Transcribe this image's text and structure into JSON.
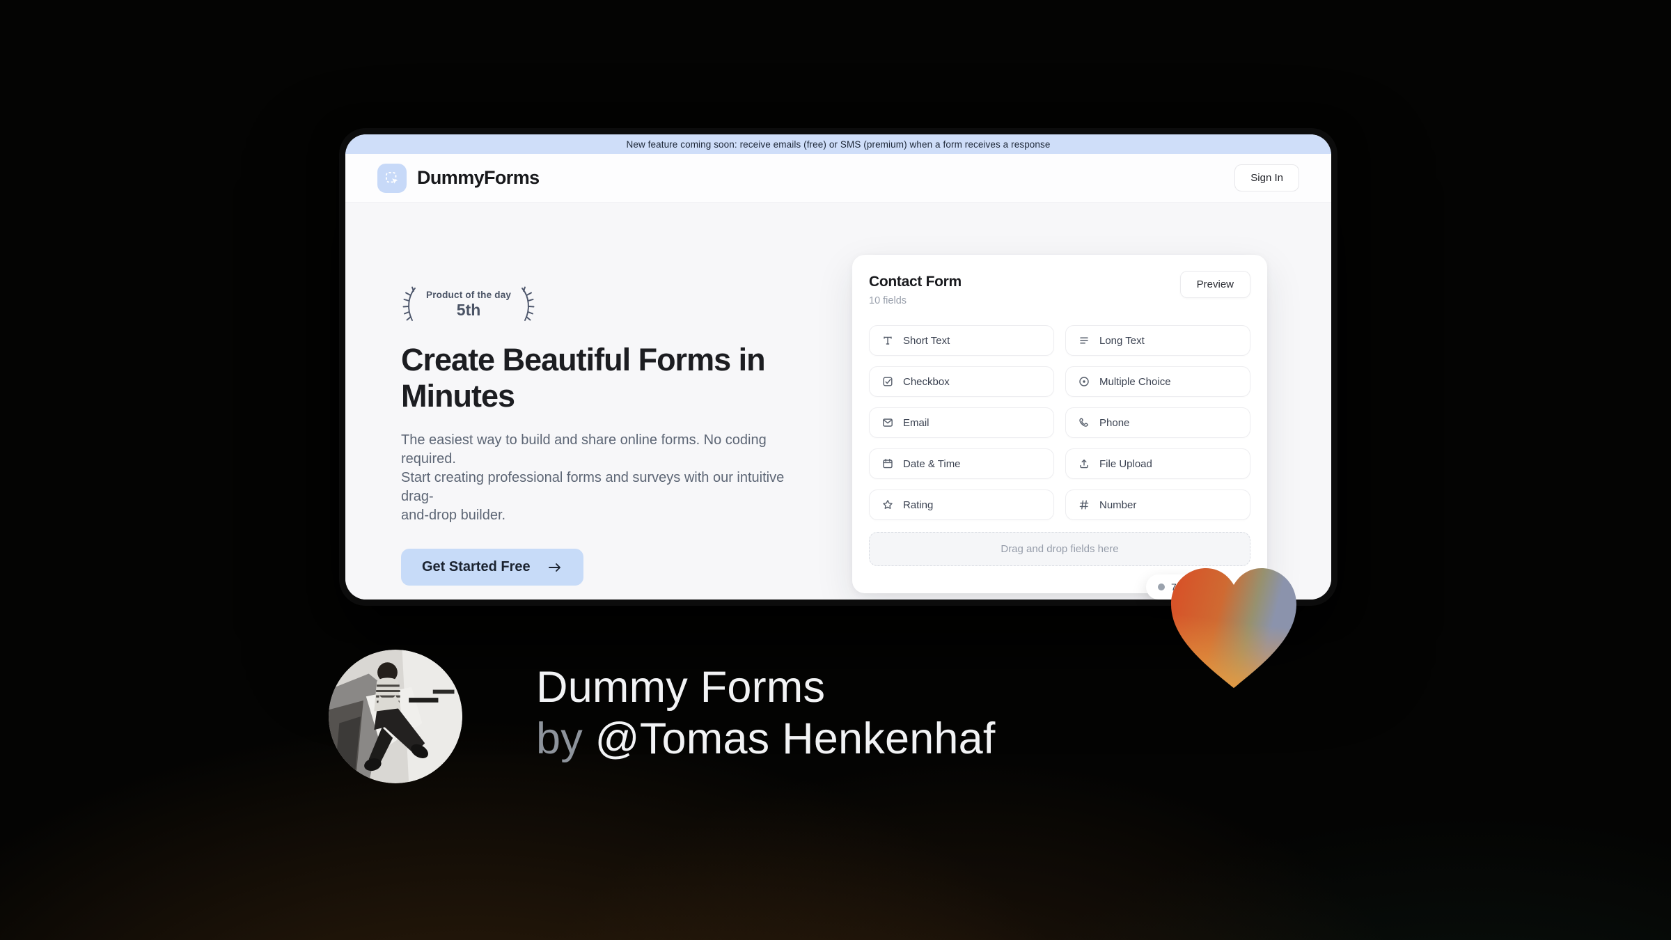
{
  "banner": {
    "text": "New feature coming soon: receive emails (free) or SMS (premium) when a form receives a response"
  },
  "header": {
    "brand": "DummyForms",
    "sign_in_label": "Sign In"
  },
  "hero": {
    "award": {
      "line1": "Product of the day",
      "line2": "5th"
    },
    "title_lines": [
      "Create Beautiful Forms in",
      "Minutes"
    ],
    "description_lines": [
      "The easiest way to build and share online forms. No coding required.",
      "Start creating professional forms and surveys with our intuitive drag-",
      "and-drop builder."
    ],
    "cta_label": "Get Started Free"
  },
  "form_builder": {
    "title": "Contact Form",
    "subtitle": "10 fields",
    "preview_label": "Preview",
    "fields": [
      {
        "label": "Short Text",
        "icon": "short-text-icon"
      },
      {
        "label": "Long Text",
        "icon": "long-text-icon"
      },
      {
        "label": "Checkbox",
        "icon": "checkbox-icon"
      },
      {
        "label": "Multiple Choice",
        "icon": "multiple-choice-icon"
      },
      {
        "label": "Email",
        "icon": "email-icon"
      },
      {
        "label": "Phone",
        "icon": "phone-icon"
      },
      {
        "label": "Date & Time",
        "icon": "calendar-icon"
      },
      {
        "label": "File Upload",
        "icon": "upload-icon"
      },
      {
        "label": "Rating",
        "icon": "star-icon"
      },
      {
        "label": "Number",
        "icon": "hash-icon"
      }
    ],
    "dropzone_text": "Drag and drop fields here",
    "vote_badge": "7"
  },
  "footer": {
    "line1": "Dummy Forms",
    "by": "by",
    "name": "@Tomas Henkenhaf"
  },
  "colors": {
    "banner_bg": "#cfdef9",
    "accent_light_blue": "#c7dbf8",
    "logo_tile_blue": "#c7d9f8",
    "heart_orange": "#d85427",
    "heart_amber": "#e89a3f",
    "heart_slate": "#8b93ac",
    "page_bg": "#040403"
  }
}
